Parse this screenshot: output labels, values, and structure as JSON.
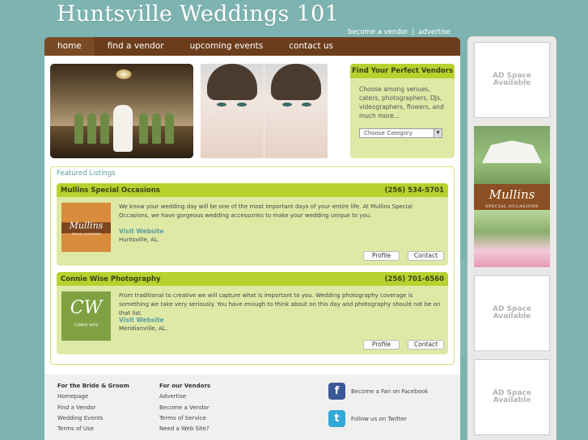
{
  "site": {
    "title": "Huntsville Weddings 101"
  },
  "top_links": {
    "become_vendor": "become a vendor",
    "separator": "|",
    "advertise": "advertise"
  },
  "nav": {
    "home": "home",
    "find_vendor": "find a vendor",
    "events": "upcoming events",
    "contact": "contact us"
  },
  "vendor_box": {
    "title": "Find Your Perfect Vendors",
    "text": "Choose among venues, caters, photographers, DJs, videographers, flowers, and much more...",
    "select_value": "Choose Category"
  },
  "featured": {
    "title": "Featured Listings",
    "listings": [
      {
        "name": "Mullins Special Occasions",
        "phone": "(256) 534-5701",
        "description": "We know your wedding day will be one of the most important days of your entire life. At Mullins Special Occasions, we have gorgeous wedding accessories to make your wedding unique to you.",
        "visit": "Visit Website",
        "city": "Huntsville, AL.",
        "profile": "Profile",
        "contact": "Contact",
        "logo_text": "Mullins",
        "logo_sub": "SPECIAL OCCASIONS"
      },
      {
        "name": "Connie Wise Photography",
        "phone": "(256) 701-6560",
        "description": "From traditional to creative we will capture what is important to you. Wedding photography coverage is something we take very seriously. You have enough to think about on this day and photography should not be on that list.",
        "visit": "Visit Website",
        "city": "Meridianville, AL.",
        "profile": "Profile",
        "contact": "Contact",
        "logo_text": "CW",
        "logo_sub": "CONNIE WISE"
      }
    ]
  },
  "footer": {
    "bride": {
      "heading": "For the Bride & Groom",
      "links": [
        "Homepage",
        "Find a Vendor",
        "Wedding Events",
        "Terms of Use"
      ]
    },
    "vendors": {
      "heading": "For our Vendors",
      "links": [
        "Advertise",
        "Become a Vendor",
        "Terms of Service",
        "Need a Web Site?"
      ]
    },
    "facebook": "Become a Fan on Facebook",
    "twitter": "Follow us on Twitter"
  },
  "ads": {
    "label_line1": "AD Space",
    "label_line2": "Available",
    "mullins_text": "Mullins",
    "mullins_sub": "SPECIAL OCCASIONS"
  },
  "colors": {
    "nav": "#6b3d1c",
    "accent_green": "#b6d22e",
    "panel_green": "#dfe9a6",
    "teal": "#5c9ea0",
    "background": "#7db3b0"
  }
}
